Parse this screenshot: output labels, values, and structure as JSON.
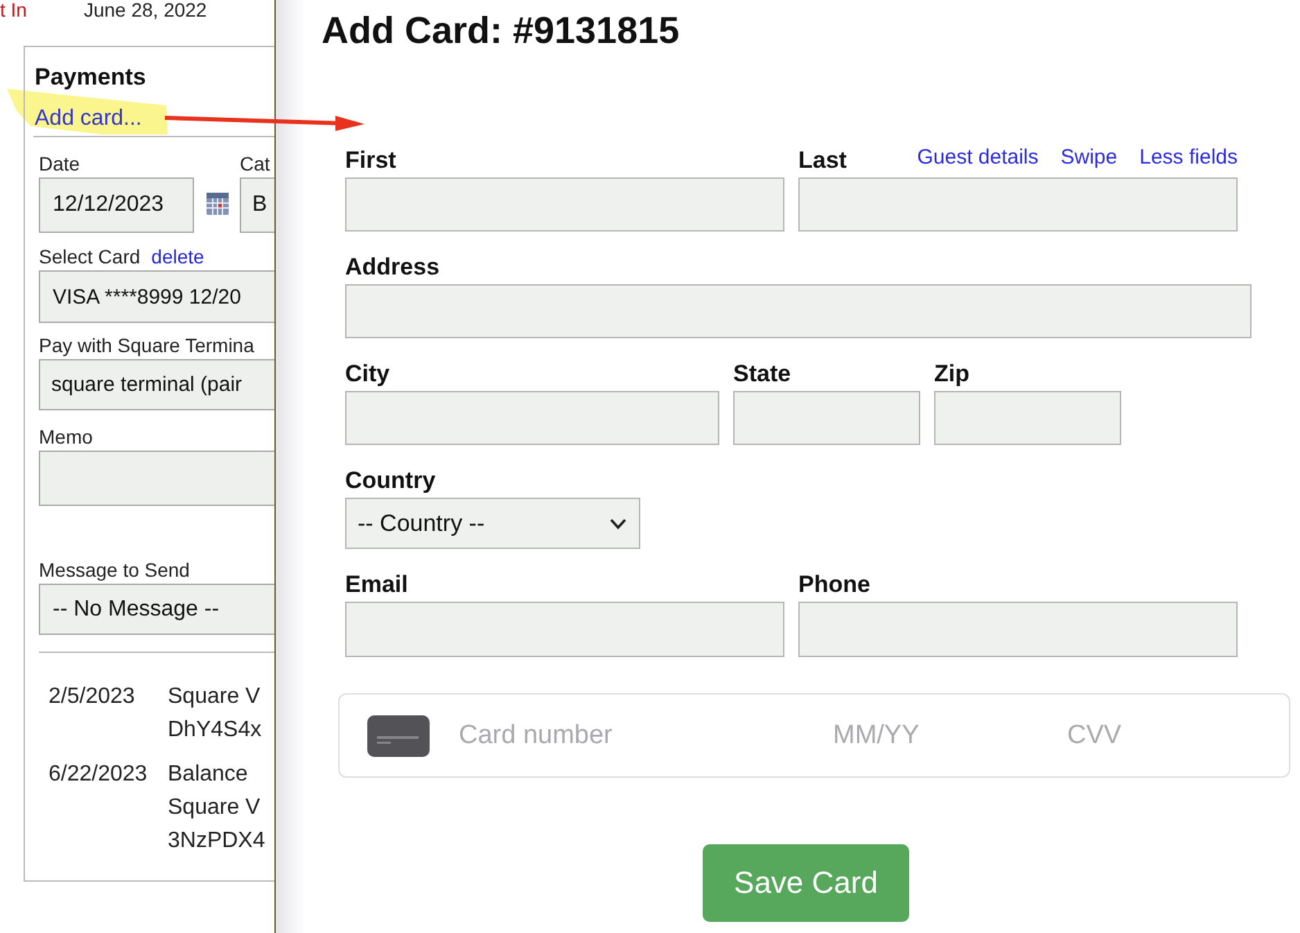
{
  "header": {
    "status": "t In",
    "date": "June 28, 2022"
  },
  "payments": {
    "title": "Payments",
    "add_card_link": "Add card...",
    "date": {
      "label": "Date",
      "value": "12/12/2023"
    },
    "category": {
      "label": "Cat",
      "value": "B"
    },
    "select_card": {
      "label": "Select Card",
      "link": "delete",
      "value": "VISA ****8999 12/20"
    },
    "terminal": {
      "label": "Pay with Square Termina",
      "value": "square terminal (pair"
    },
    "memo": {
      "label": "Memo"
    },
    "message": {
      "label": "Message to Send",
      "value": "-- No Message --"
    },
    "transactions": [
      {
        "date": "2/5/2023",
        "lines": [
          "Square V",
          "DhY4S4x"
        ]
      },
      {
        "date": "6/22/2023",
        "lines": [
          "Balance",
          "Square V",
          "3NzPDX4"
        ]
      }
    ]
  },
  "dialog": {
    "title": "Add Card: #9131815",
    "rows": [
      {
        "fields": [
          {
            "label": "First",
            "kind": "text"
          },
          {
            "label": "Last",
            "kind": "text"
          }
        ],
        "links": [
          "Guest details",
          "Swipe",
          "Less fields"
        ]
      },
      {
        "fields": [
          {
            "label": "Address",
            "kind": "text"
          }
        ]
      },
      {
        "fields": [
          {
            "label": "City",
            "kind": "text"
          },
          {
            "label": "State",
            "kind": "text"
          },
          {
            "label": "Zip",
            "kind": "text"
          }
        ]
      },
      {
        "fields": [
          {
            "label": "Country",
            "kind": "select",
            "value": "-- Country --"
          }
        ]
      },
      {
        "fields": [
          {
            "label": "Email",
            "kind": "text"
          },
          {
            "label": "Phone",
            "kind": "text"
          }
        ]
      }
    ],
    "card_entry": {
      "number": {
        "placeholder": "Card number"
      },
      "expiry": {
        "placeholder": "MM/YY"
      },
      "cvv": {
        "placeholder": "CVV"
      }
    },
    "save_button": "Save Card"
  }
}
